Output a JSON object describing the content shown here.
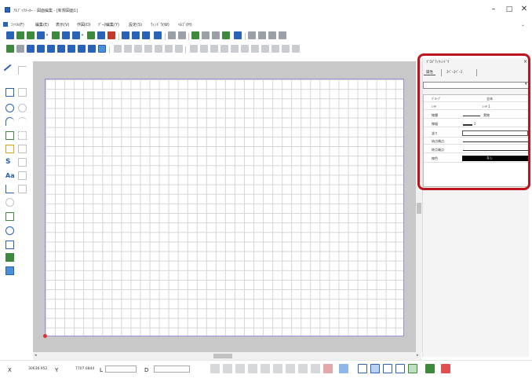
{
  "window": {
    "title": "ｱﾙﾌﾞｯｸﾒｰｶｰ - 図面編集 - [新規図面1]",
    "minimize_glyph": "–",
    "maximize_glyph": "□",
    "close_glyph": "✕"
  },
  "menu": {
    "items": [
      "ﾌｧｲﾙ(F)",
      "編集(E)",
      "表示(V)",
      "作図(D)",
      "ﾃﾞｰﾀ編集(Y)",
      "設定(S)",
      "ｳｨﾝﾄﾞｳ(W)",
      "ﾍﾙﾌﾟ(H)"
    ],
    "collapse_glyph": "⌄"
  },
  "toolbar": {
    "main_icons": [
      "new-icon",
      "open-icon",
      "open-template-icon",
      "save-as-icon",
      "save-icon",
      "save-all-icon",
      "export-icon",
      "import-icon",
      "print-preview-icon",
      "print-icon",
      "print-settings-icon",
      "print-range-icon",
      "display-icon",
      "undo-icon",
      "redo-icon",
      "cut-icon",
      "copy-icon",
      "paste-icon",
      "paste-special-icon",
      "find-icon",
      "zoom-in-icon",
      "zoom-out-icon",
      "zoom-window-icon",
      "zoom-fit-icon"
    ],
    "edit_icons": [
      "select-icon",
      "delete-icon",
      "grid-icon",
      "snap-icon",
      "frame-icon",
      "close-window-icon",
      "table-icon",
      "measure-icon",
      "fill-tool-icon"
    ],
    "colors": {
      "blue": "#2a62b8",
      "green": "#3d8a3d",
      "red": "#c0392b",
      "gray": "#9aa0a6"
    }
  },
  "tools": {
    "labels": [
      "Aa",
      "S"
    ],
    "icons": [
      "line-icon",
      "polyline-icon",
      "rectangle-icon",
      "rectangle-alt-icon",
      "circle-icon",
      "ellipse-icon",
      "arc-icon",
      "circle-arc-icon",
      "point-icon",
      "symbol-icon",
      "spline-icon",
      "dimension-icon",
      "text-icon",
      "text-alt-icon",
      "table-tool-icon",
      "hatch-icon",
      "image-tool-icon",
      "zoom-tool-icon",
      "frame-tool-icon",
      "layer-tool-icon",
      "picture-tool-icon"
    ]
  },
  "canvas": {
    "paper_border_color": "#9b8fd8",
    "origin_color": "#e03030"
  },
  "panel": {
    "title": "ﾌﾟﾛﾊﾟﾃｨｳｨﾝﾄﾞｳ",
    "close_glyph": "×",
    "tabs": [
      "属性",
      "ｽﾍﾟｰｽﾍﾟｰｽ"
    ],
    "select_value": "",
    "rows": [
      {
        "label": "ｸﾞﾙｰﾌﾟ",
        "value": "全体"
      },
      {
        "label": "ﾚｲﾔ",
        "value": "ﾚｲﾔ 1"
      },
      {
        "label": "線種",
        "value": "実線"
      },
      {
        "label": "線幅",
        "value": "2"
      },
      {
        "label": "塗り",
        "value": ""
      },
      {
        "label": "始点端点",
        "value": ""
      },
      {
        "label": "終点端点",
        "value": ""
      },
      {
        "label": "線色",
        "value": "なし"
      }
    ],
    "highlight_color": "#c0141c"
  },
  "status": {
    "x_label": "X",
    "x_value": "30636.952",
    "y_label": "Y",
    "y_value": "7707.6844",
    "l_label": "L",
    "d_label": "D",
    "l_value": "",
    "d_value": ""
  }
}
